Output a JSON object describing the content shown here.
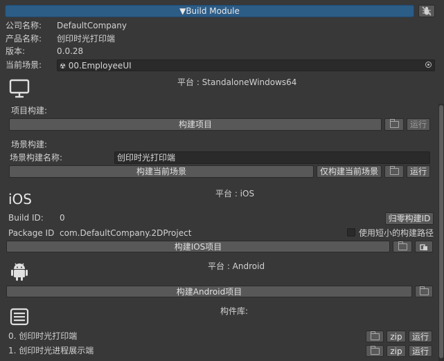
{
  "header": {
    "build_module_label": "▼Build Module"
  },
  "info": {
    "company_label": "公司名称:",
    "company_value": "DefaultCompany",
    "product_label": "产品名称:",
    "product_value": "创印时光打印端",
    "version_label": "版本:",
    "version_value": "0.0.28",
    "scene_label": "当前场景:",
    "scene_value": "00.EmployeeUI"
  },
  "windows": {
    "platform_label": "平台 : StandaloneWindows64",
    "project_build_label": "项目构建:",
    "build_project_button": "构建项目",
    "run_button": "运行",
    "scene_build_label": "场景构建:",
    "scene_build_name_label": "场景构建名称:",
    "scene_build_name_value": "创印时光打印端",
    "build_current_scene_button": "构建当前场景",
    "build_only_current_scene_button": "仅构建当前场景",
    "run_button_2": "运行"
  },
  "ios": {
    "logo_text": "iOS",
    "platform_label": "平台 : iOS",
    "build_id_label": "Build ID:",
    "build_id_value": "0",
    "reset_build_id_button": "归零构建ID",
    "package_id_label": "Package ID",
    "package_id_value": "com.DefaultCompany.2DProject",
    "short_path_label": "使用短小的构建路径",
    "short_path_checked": false,
    "build_ios_button": "构建IOS项目"
  },
  "android": {
    "platform_label": "平台 : Android",
    "build_android_button": "构建Android项目"
  },
  "library": {
    "title": "构件库:",
    "items": [
      {
        "label": "0. 创印时光打印端",
        "zip": "zip",
        "run": "运行"
      },
      {
        "label": "1. 创印时光进程展示端",
        "zip": "zip",
        "run": "运行"
      }
    ]
  }
}
